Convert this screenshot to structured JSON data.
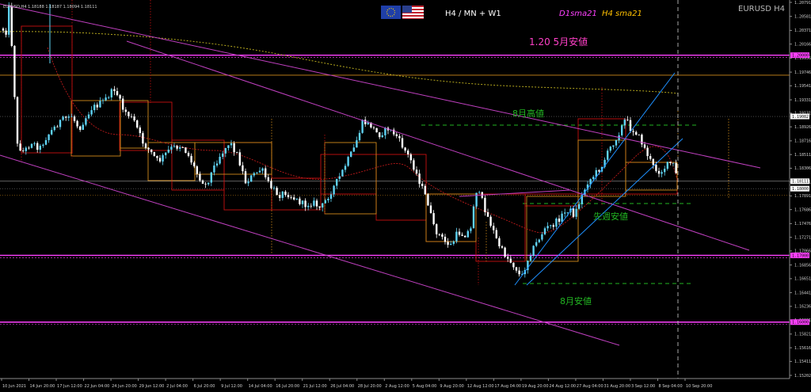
{
  "window": {
    "header": "EURUSD,H4  1.18188 1.18187 1.18094 1.18111",
    "symbol_label": "EURUSD H4",
    "timeframes": "H4 / MN + W1",
    "legend_d1": "D1sma21",
    "legend_h4": "H4 sma21"
  },
  "annotations": {
    "may_low": "1.20  5月安値",
    "aug_high": "8月高値",
    "last_week_low": "先週安値",
    "aug_low": "8月安値"
  },
  "colors": {
    "bull": "#5fd3f3",
    "bear": "#ffffff",
    "channel": "#c040c0",
    "blue_channel": "#1e90ff",
    "magenta_level": "#ff40ff",
    "annotation_green": "#22b522",
    "annotation_pink": "#ff40c8",
    "monthly_box": "#d08a1a",
    "weekly_box": "#c81010",
    "legend_d1_color": "#ff40ff",
    "legend_h4_color": "#ffc000"
  },
  "chart_data": {
    "type": "candlestick",
    "symbol": "EURUSD",
    "timeframe": "H4",
    "ylim": [
      1.15202,
      1.20791
    ],
    "price_ticks": [
      "1.20791",
      "1.20581",
      "1.20371",
      "1.20166",
      "1.19956",
      "1.19746",
      "1.19541",
      "1.19331",
      "1.19131",
      "1.18926",
      "1.18716",
      "1.18511",
      "1.18306",
      "1.18101",
      "1.17891",
      "1.17686",
      "1.17476",
      "1.17271",
      "1.17066",
      "1.16856",
      "1.16651",
      "1.16441",
      "1.16236",
      "1.16031",
      "1.15821",
      "1.15616",
      "1.15411",
      "1.15202"
    ],
    "price_markers": [
      {
        "label": "1.20000",
        "value": 1.2,
        "color": "#ff40ff"
      },
      {
        "label": "1.19082",
        "value": 1.19082,
        "color": "#ffffff"
      },
      {
        "label": "1.18111",
        "value": 1.18111,
        "color": "#ffffff"
      },
      {
        "label": "1.18000",
        "value": 1.18,
        "color": "#ffffff"
      },
      {
        "label": "1.17000",
        "value": 1.17,
        "color": "#ff40ff"
      },
      {
        "label": "1.16000",
        "value": 1.16,
        "color": "#ff40ff"
      }
    ],
    "time_ticks": [
      "10 Jun 2021",
      "14 Jun 20:00",
      "17 Jun 12:00",
      "22 Jun 04:00",
      "24 Jun 20:00",
      "29 Jun 12:00",
      "2 Jul 04:00",
      "6 Jul 20:00",
      "9 Jul 12:00",
      "14 Jul 04:00",
      "16 Jul 20:00",
      "21 Jul 12:00",
      "26 Jul 04:00",
      "28 Jul 20:00",
      "2 Aug 12:00",
      "5 Aug 04:00",
      "9 Aug 20:00",
      "12 Aug 12:00",
      "17 Aug 04:00",
      "19 Aug 20:00",
      "24 Aug 12:00",
      "27 Aug 04:00",
      "31 Aug 20:00",
      "3 Sep 12:00",
      "8 Sep 04:00",
      "10 Sep 20:00"
    ],
    "path": [
      [
        1.204,
        2
      ],
      [
        1.2035,
        8
      ],
      [
        1.208,
        12
      ],
      [
        1.199,
        16
      ],
      [
        1.1865,
        22
      ],
      [
        1.1855,
        30
      ],
      [
        1.187,
        40
      ],
      [
        1.186,
        50
      ],
      [
        1.188,
        60
      ],
      [
        1.19,
        75
      ],
      [
        1.191,
        90
      ],
      [
        1.189,
        100
      ],
      [
        1.192,
        115
      ],
      [
        1.193,
        130
      ],
      [
        1.195,
        145
      ],
      [
        1.192,
        155
      ],
      [
        1.19,
        170
      ],
      [
        1.187,
        180
      ],
      [
        1.1855,
        190
      ],
      [
        1.184,
        200
      ],
      [
        1.186,
        215
      ],
      [
        1.1865,
        230
      ],
      [
        1.1845,
        240
      ],
      [
        1.182,
        250
      ],
      [
        1.1805,
        260
      ],
      [
        1.1845,
        275
      ],
      [
        1.187,
        290
      ],
      [
        1.185,
        300
      ],
      [
        1.181,
        310
      ],
      [
        1.1825,
        325
      ],
      [
        1.183,
        330
      ],
      [
        1.1805,
        340
      ],
      [
        1.179,
        352
      ],
      [
        1.1795,
        360
      ],
      [
        1.1785,
        372
      ],
      [
        1.1775,
        385
      ],
      [
        1.178,
        395
      ],
      [
        1.177,
        405
      ],
      [
        1.179,
        415
      ],
      [
        1.182,
        430
      ],
      [
        1.184,
        438
      ],
      [
        1.186,
        447
      ],
      [
        1.19,
        458
      ],
      [
        1.1895,
        468
      ],
      [
        1.188,
        478
      ],
      [
        1.189,
        490
      ],
      [
        1.188,
        500
      ],
      [
        1.186,
        510
      ],
      [
        1.184,
        520
      ],
      [
        1.181,
        530
      ],
      [
        1.178,
        540
      ],
      [
        1.174,
        548
      ],
      [
        1.173,
        555
      ],
      [
        1.172,
        562
      ],
      [
        1.1715,
        570
      ],
      [
        1.1735,
        578
      ],
      [
        1.173,
        586
      ],
      [
        1.174,
        595
      ],
      [
        1.18,
        600
      ],
      [
        1.1785,
        608
      ],
      [
        1.176,
        615
      ],
      [
        1.174,
        622
      ],
      [
        1.172,
        628
      ],
      [
        1.1705,
        635
      ],
      [
        1.169,
        645
      ],
      [
        1.168,
        652
      ],
      [
        1.1665,
        658
      ],
      [
        1.17,
        668
      ],
      [
        1.172,
        678
      ],
      [
        1.174,
        688
      ],
      [
        1.1745,
        698
      ],
      [
        1.176,
        710
      ],
      [
        1.177,
        718
      ],
      [
        1.176,
        725
      ],
      [
        1.179,
        735
      ],
      [
        1.181,
        742
      ],
      [
        1.182,
        750
      ],
      [
        1.1835,
        760
      ],
      [
        1.186,
        770
      ],
      [
        1.188,
        780
      ],
      [
        1.1905,
        790
      ],
      [
        1.189,
        796
      ],
      [
        1.1885,
        803
      ],
      [
        1.187,
        810
      ],
      [
        1.185,
        818
      ],
      [
        1.183,
        826
      ],
      [
        1.1825,
        834
      ],
      [
        1.1835,
        842
      ],
      [
        1.184,
        849
      ],
      [
        1.1811,
        856
      ]
    ],
    "candles": "generated by script: one candle every 3.6 px along the path, with small deterministic noise"
  }
}
